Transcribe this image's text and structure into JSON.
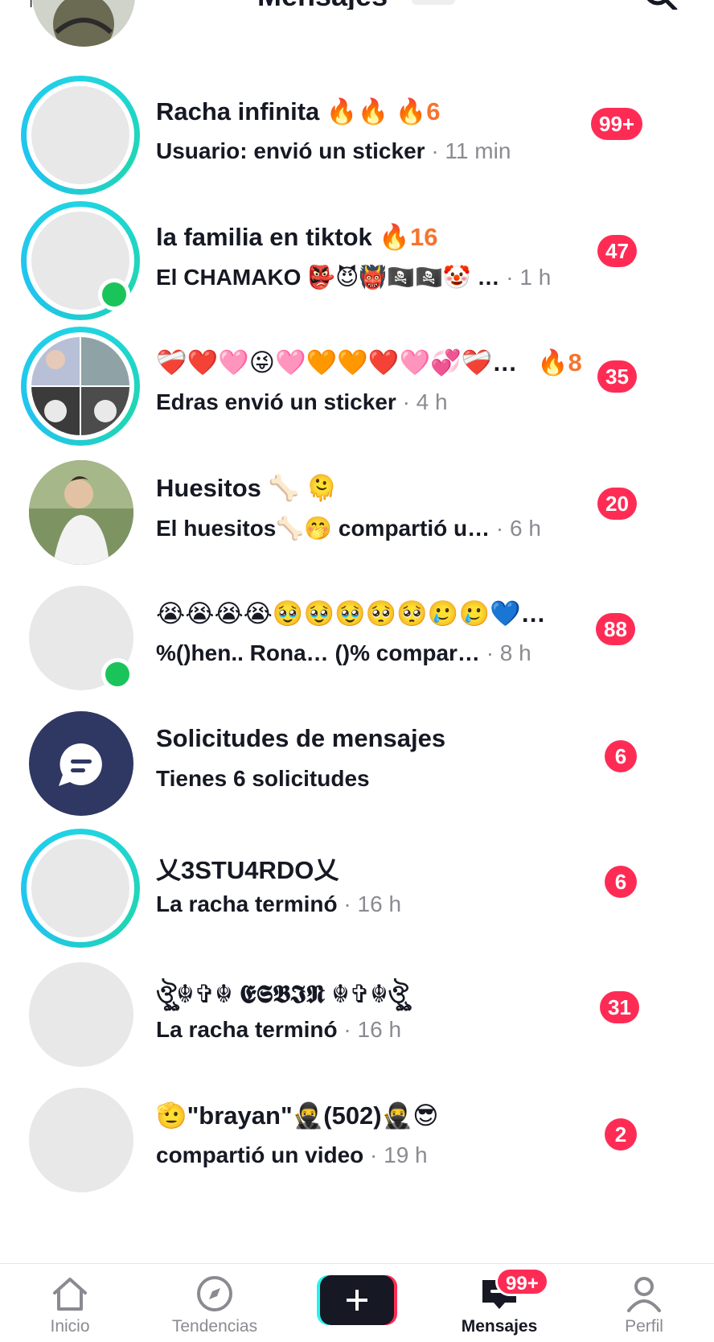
{
  "header": {
    "left_glyph": "↑↓",
    "title": "Mensajes"
  },
  "conversations": [
    {
      "name": "Racha infinita 🔥🔥",
      "streak": "🔥6",
      "preview": "Usuario: envió un sticker",
      "time": " · 11 min",
      "badge": "99+"
    },
    {
      "name": "la familia en tiktok ",
      "streak": "🔥16",
      "preview": "El CHAMAKO 👺😈👹🏴‍☠️🏴‍☠️🤡 …",
      "time": " · 1 h",
      "badge": "47"
    },
    {
      "name": "❤️‍🩹❤️🩷😜🩷🧡🧡❤️🩷💞❤️‍🩹…",
      "streak": "🔥8",
      "preview": "Edras envió un sticker",
      "time": " · 4 h",
      "badge": "35"
    },
    {
      "name": "Huesitos 🦴 🫠",
      "streak": "",
      "preview": "El huesitos🦴🤭 compartió u…",
      "time": " · 6 h",
      "badge": "20"
    },
    {
      "name": "😭😭😭😭🥹🥹🥹🥺🥺🥲🥲💙…",
      "streak": "",
      "preview": "%()hen.. Rona… ()% compar…",
      "time": " · 8 h",
      "badge": "88"
    },
    {
      "name": "Solicitudes de mensajes",
      "streak": "",
      "preview": "Tienes 6 solicitudes",
      "time": "",
      "badge": "6"
    },
    {
      "name": "乂3STU4RDO乂",
      "streak": "",
      "preview": "La racha terminó",
      "time": " · 16 h",
      "badge": "6"
    },
    {
      "name": "ঔৣ☬✞☬ 𝕰𝕾𝕭𝕴𝕹 ☬✞☬ঔৣ",
      "streak": "",
      "preview": "La racha terminó",
      "time": " · 16 h",
      "badge": "31"
    },
    {
      "name": "🫡\"brayan\"🥷(502)🥷😎",
      "streak": "",
      "preview": "compartió un video",
      "time": " · 19 h",
      "badge": "2"
    }
  ],
  "bottom_nav": {
    "home": "Inicio",
    "trends": "Tendencias",
    "messages": "Mensajes",
    "profile": "Perfil",
    "messages_badge": "99+"
  },
  "colors": {
    "accent_red": "#fe2c55",
    "streak_orange": "#f5742e",
    "ring_cyan": "#21d4e3",
    "online_green": "#1bc45a",
    "request_icon_bg": "#2f3763"
  }
}
